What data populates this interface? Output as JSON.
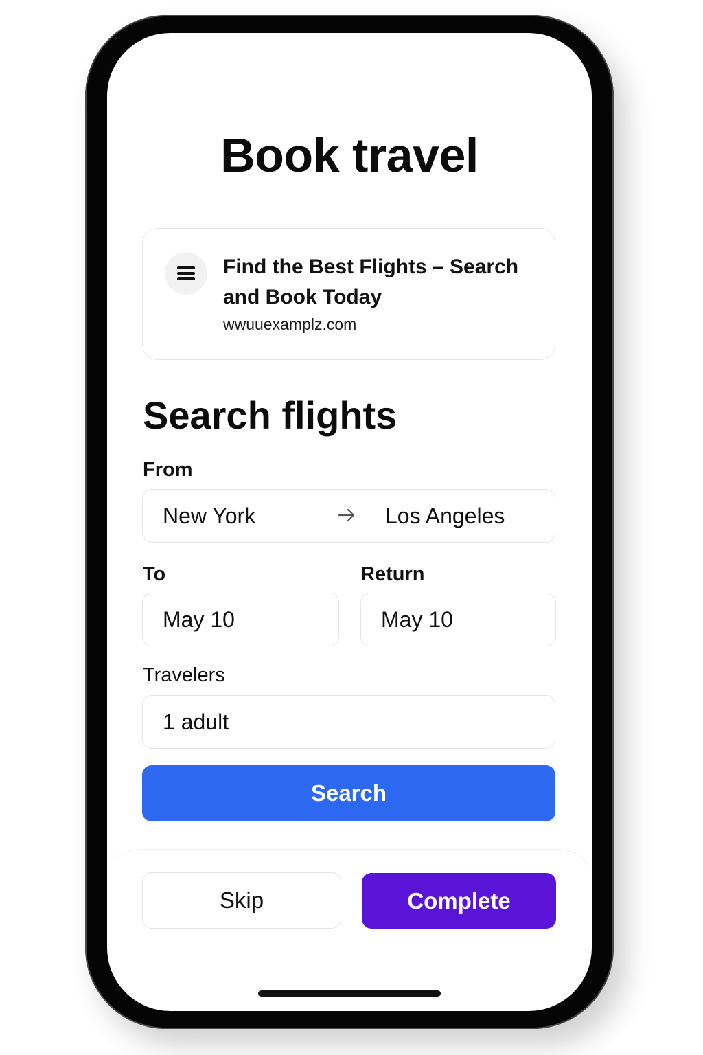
{
  "page": {
    "title": "Book travel"
  },
  "ad": {
    "icon": "menu-icon",
    "title": "Find the Best Flights – Search and Book Today",
    "url": "wwuuexamplz.com"
  },
  "search": {
    "section_title": "Search flights",
    "from_label": "From",
    "origin": "New York",
    "destination": "Los Angeles",
    "route_icon": "arrow-right-icon",
    "to_label": "To",
    "depart_date": "May 10",
    "return_label": "Return",
    "return_date": "May 10",
    "travelers_label": "Travelers",
    "travelers_value": "1 adult",
    "search_label": "Search"
  },
  "footer": {
    "skip_label": "Skip",
    "complete_label": "Complete"
  },
  "colors": {
    "search_button": "#2d68f0",
    "complete_button": "#5a14d8",
    "text": "#111111"
  }
}
